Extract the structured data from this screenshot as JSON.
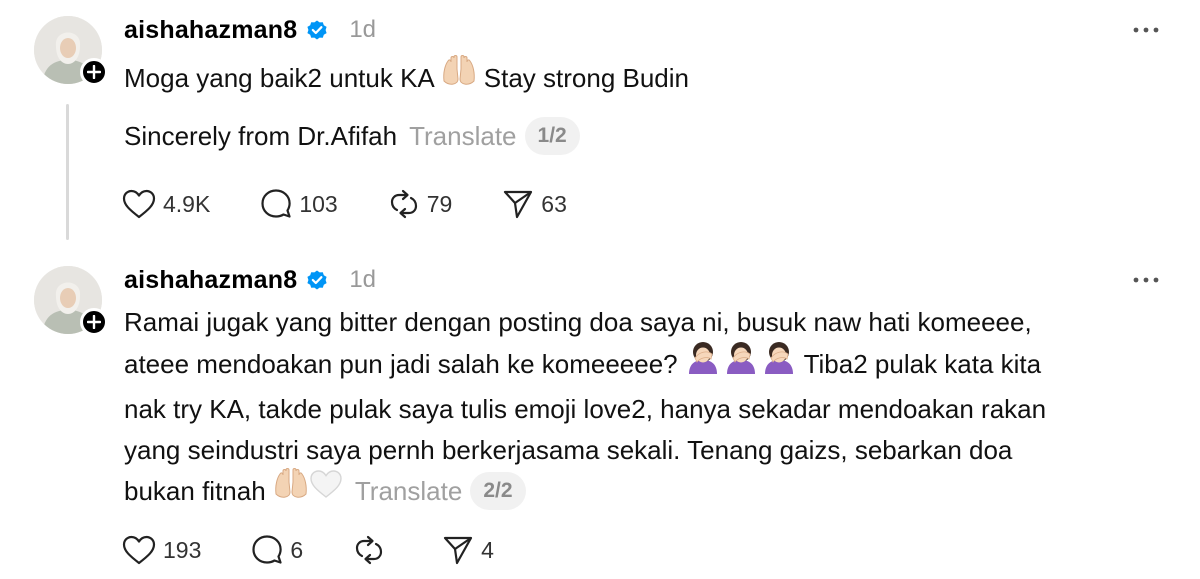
{
  "posts": [
    {
      "username": "aishahazman8",
      "time": "1d",
      "line1_pre": "Moga yang baik2 untuk KA ",
      "line1_post": " Stay strong Budin",
      "line2": "Sincerely from Dr.Afifah",
      "translate": "Translate",
      "page": "1/2",
      "likes": "4.9K",
      "replies": "103",
      "reposts": "79",
      "shares": "63"
    },
    {
      "username": "aishahazman8",
      "time": "1d",
      "line1": "Ramai jugak yang bitter dengan posting doa saya ni, busuk naw hati komeeee,",
      "line2_pre": "ateee mendoakan pun jadi salah ke komeeeee? ",
      "line2_post": " Tiba2 pulak kata kita",
      "line3": "nak try KA, takde pulak saya tulis emoji love2, hanya sekadar mendoakan rakan",
      "line4": "yang seindustri saya pernh berkerjasama sekali. Tenang gaizs, sebarkan doa",
      "line5_pre": "bukan fitnah ",
      "translate": "Translate",
      "page": "2/2",
      "likes": "193",
      "replies": "6",
      "reposts": "",
      "shares": "4"
    }
  ],
  "icons": {
    "verified": "verified-badge-icon",
    "more": "more-options-icon",
    "like": "heart-icon",
    "reply": "comment-bubble-icon",
    "repost": "repost-icon",
    "share": "send-icon",
    "follow": "plus-icon",
    "emoji_hands": "raised-hands-emoji",
    "emoji_facepalm": "woman-facepalming-emoji",
    "emoji_heart": "white-heart-emoji"
  },
  "colors": {
    "verified": "#0095f6",
    "muted": "#999999",
    "pill_bg": "#f1f1f1"
  }
}
